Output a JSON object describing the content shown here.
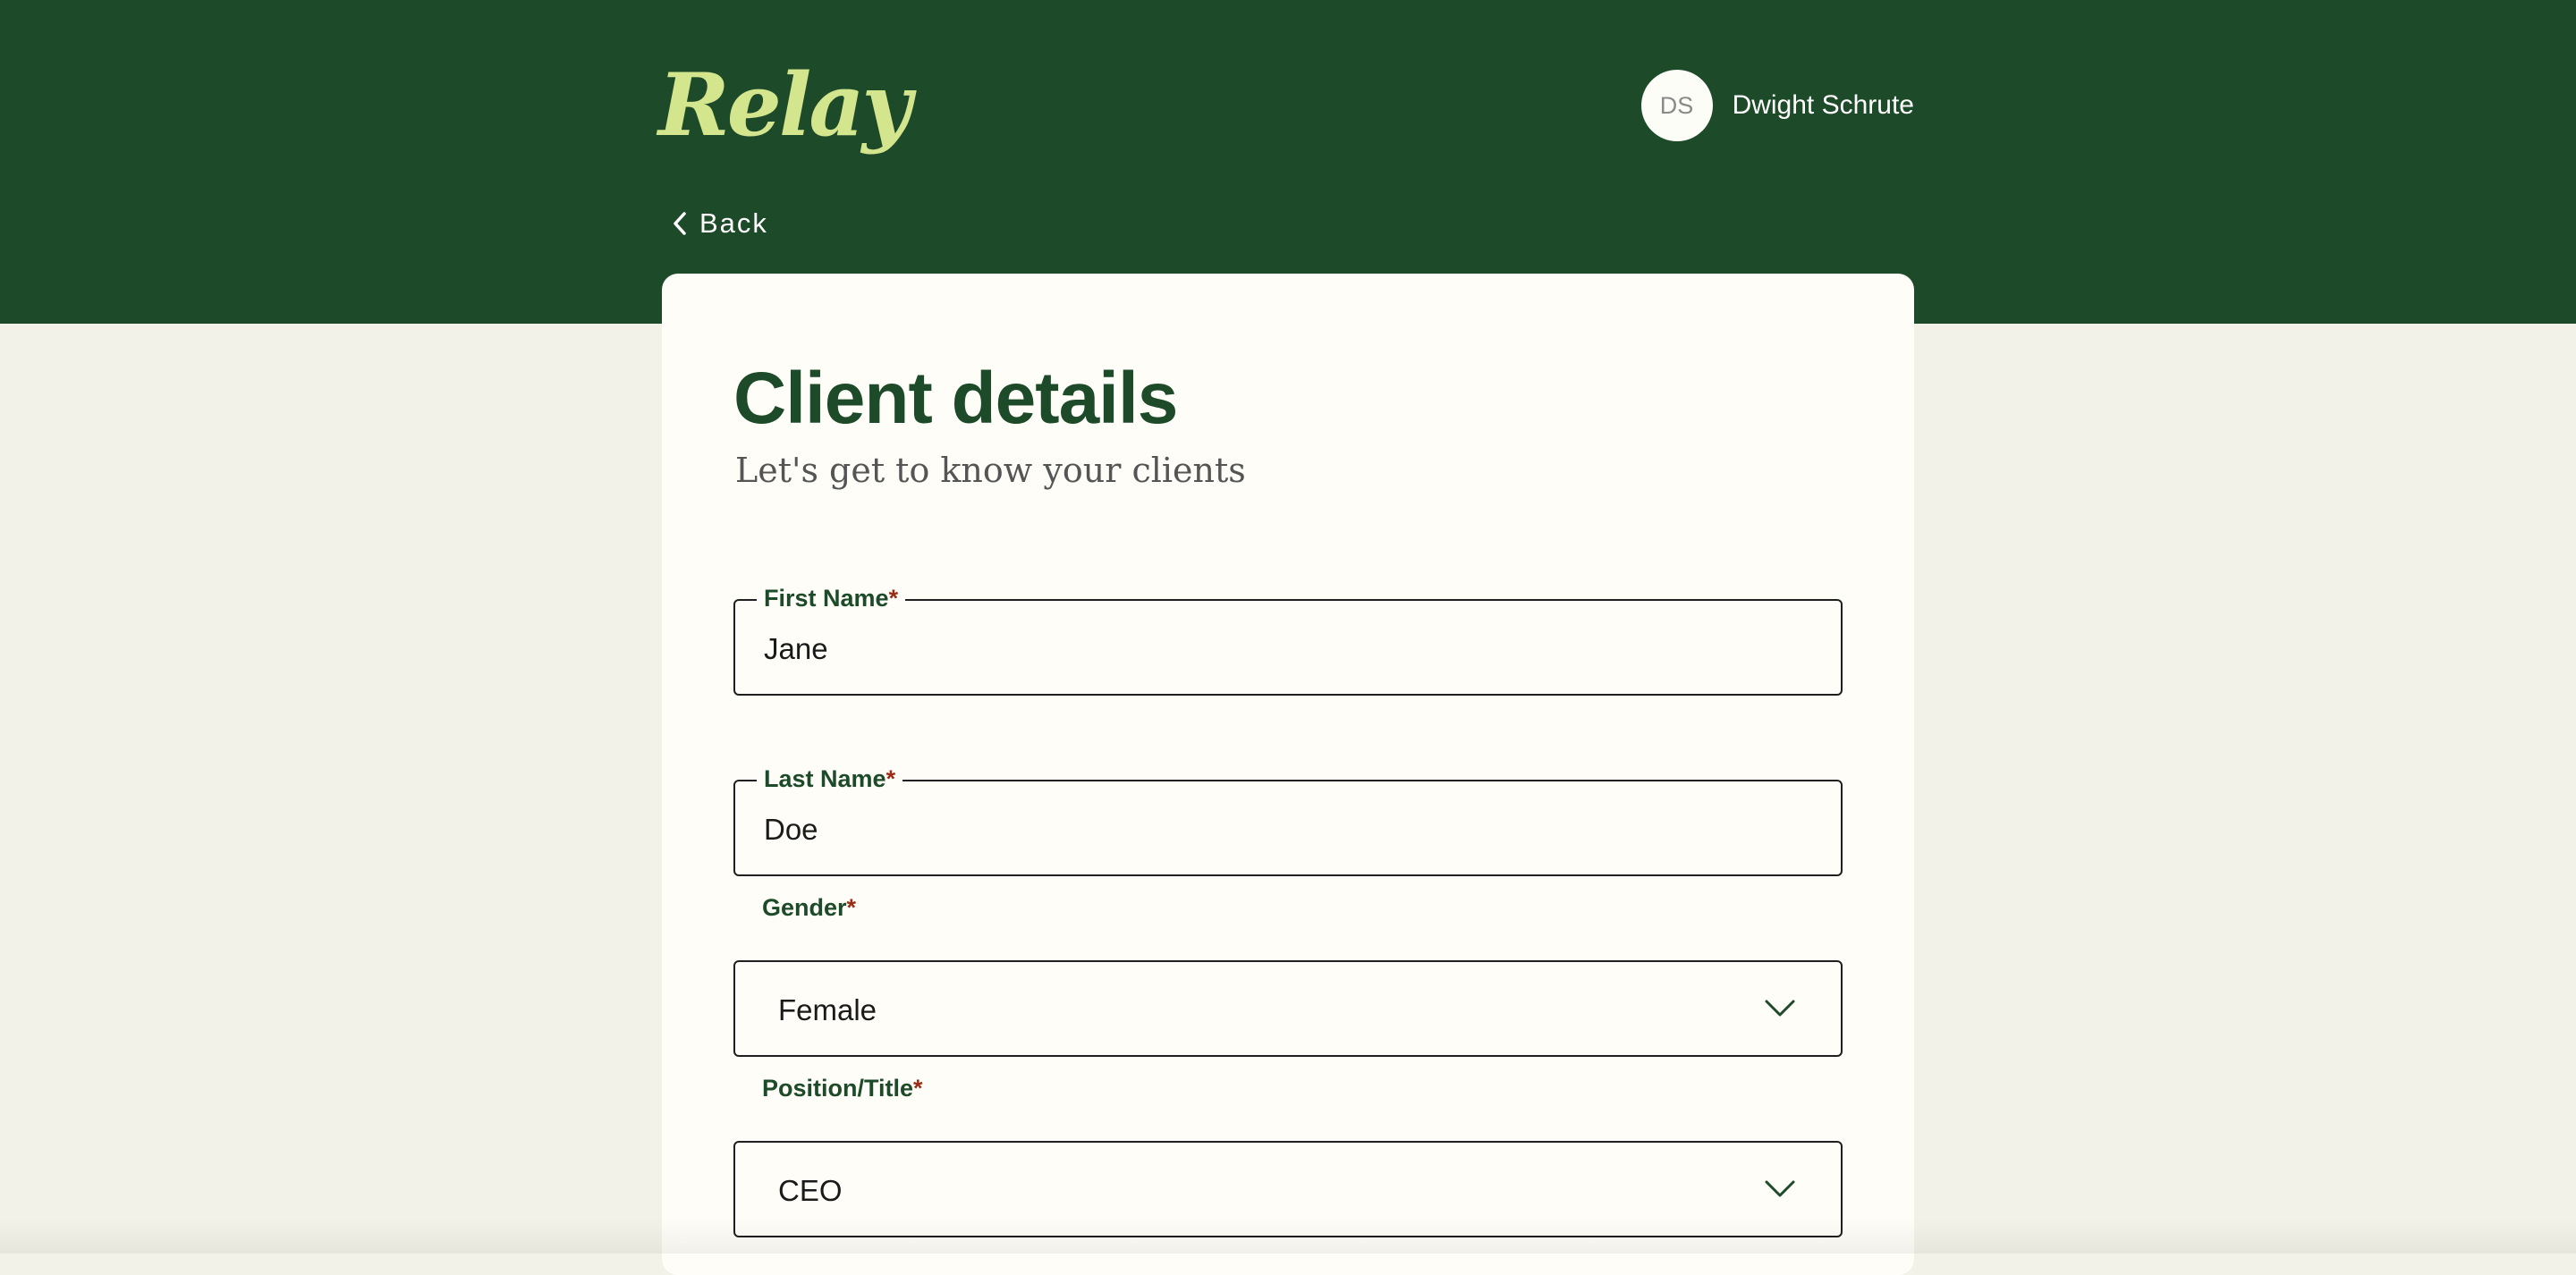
{
  "header": {
    "logo_text": "Relay",
    "user": {
      "initials": "DS",
      "name": "Dwight Schrute"
    },
    "back_label": "Back"
  },
  "form": {
    "title": "Client details",
    "subtitle": "Let's get to know your clients",
    "required_mark": "*",
    "first_name": {
      "label": "First Name",
      "value": "Jane"
    },
    "last_name": {
      "label": "Last Name",
      "value": "Doe"
    },
    "gender": {
      "label": "Gender",
      "value": "Female"
    },
    "position": {
      "label": "Position/Title",
      "value": "CEO"
    }
  },
  "colors": {
    "brand_green": "#1d4a28",
    "logo_lime": "#d3e58d",
    "page_background": "#f3f2e8",
    "card_background": "#fefdf8",
    "required_mark": "#9a2c15"
  },
  "icons": {
    "back": "chevron-left-icon",
    "select": "chevron-down-icon"
  }
}
